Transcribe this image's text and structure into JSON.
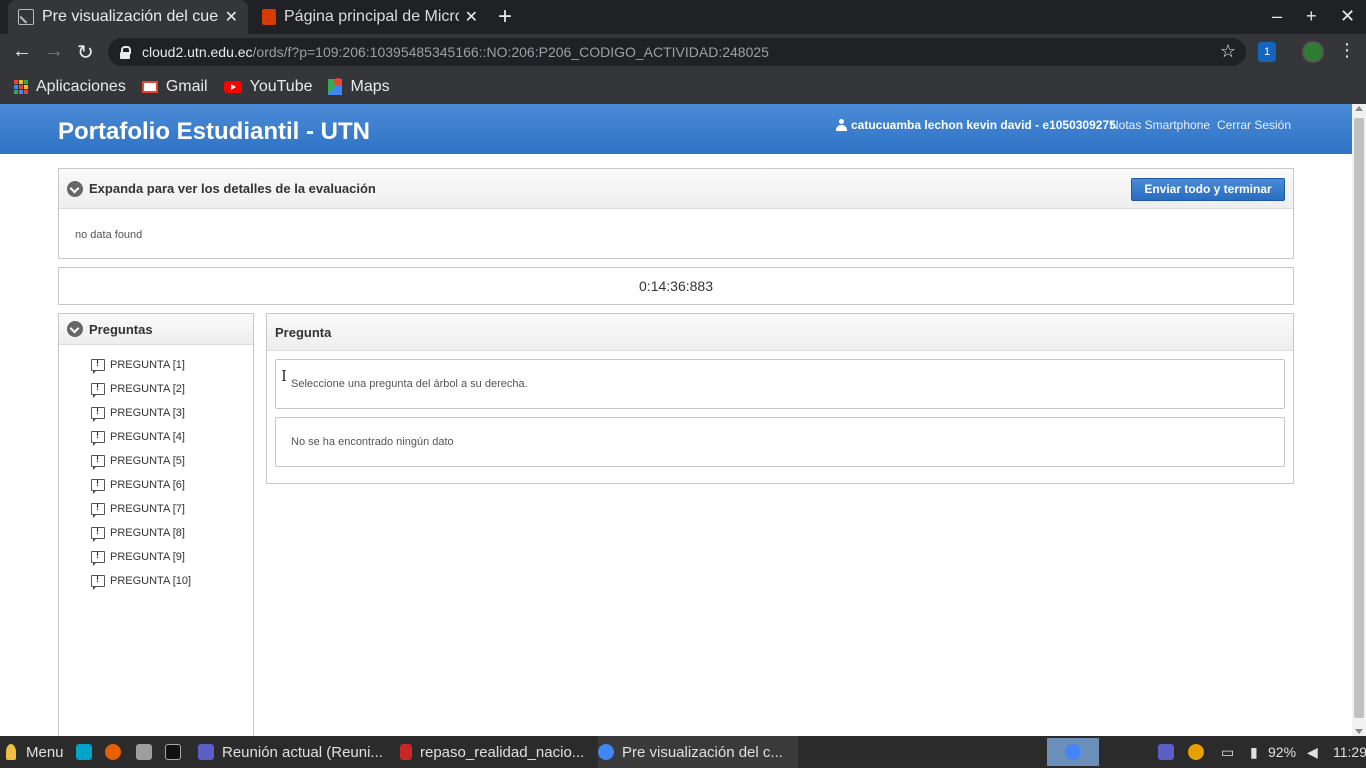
{
  "browser": {
    "tabs": [
      {
        "title": "Pre visualización del cuestionario",
        "active": true
      },
      {
        "title": "Página principal de Microsoft Office",
        "active": false
      }
    ],
    "new_tab": "+",
    "window_controls": {
      "minimize": "–",
      "maximize": "+",
      "close": "✕"
    },
    "url_host": "cloud2.utn.edu.ec",
    "url_path": "/ords/f?p=109:206:10395485345166::NO:206:P206_CODIGO_ACTIVIDAD:248025",
    "extension_badge": "1",
    "bookmarks": [
      {
        "label": "Aplicaciones",
        "icon": "apps-grid-icon"
      },
      {
        "label": "Gmail",
        "icon": "gmail-icon"
      },
      {
        "label": "YouTube",
        "icon": "youtube-icon"
      },
      {
        "label": "Maps",
        "icon": "maps-icon"
      }
    ]
  },
  "header": {
    "title": "Portafolio Estudiantil - UTN",
    "user": "catucuamba lechon kevin david - e1050309275",
    "links": [
      "Notas Smartphone",
      "Cerrar Sesión"
    ]
  },
  "evaluation": {
    "heading": "Expanda para ver los detalles de la evaluación",
    "submit_label": "Enviar todo y terminar",
    "empty_text": "no data found"
  },
  "timer": "0:14:36:883",
  "questions": {
    "heading": "Preguntas",
    "items": [
      "PREGUNTA [1]",
      "PREGUNTA [2]",
      "PREGUNTA [3]",
      "PREGUNTA [4]",
      "PREGUNTA [5]",
      "PREGUNTA [6]",
      "PREGUNTA [7]",
      "PREGUNTA [8]",
      "PREGUNTA [9]",
      "PREGUNTA [10]"
    ]
  },
  "question_panel": {
    "heading": "Pregunta",
    "instruction": "Seleccione una pregunta del árbol a su derecha.",
    "empty_text": "No se ha encontrado ningún dato"
  },
  "taskbar": {
    "menu": "Menu",
    "windows": [
      "Reunión actual (Reuni...",
      "repaso_realidad_nacio...",
      "Pre visualización del c..."
    ],
    "battery": "92%",
    "clock": "11:29"
  },
  "colors": {
    "header_blue": "#2f73c5",
    "button_blue": "#2a6cc0",
    "chrome_dark": "#202124"
  }
}
